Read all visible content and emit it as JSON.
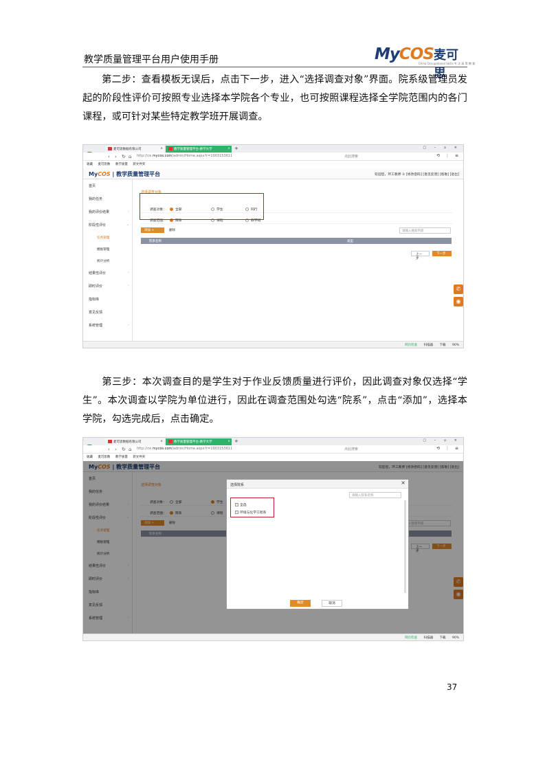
{
  "header": {
    "doc_title": "教学质量管理平台用户使用手册",
    "logo_text_my": "My",
    "logo_text_cos": "COS",
    "logo_cn": "麦可思",
    "logo_sub": "China Occupational Skills 专 注 高 等 教 育"
  },
  "paragraphs": {
    "step2": "第二步：查看模板无误后，点击下一步，进入“选择调查对象”界面。院系级管理员发起的阶段性评价可按照专业选择本学院各个专业，也可按照课程选择全学院范围内的各门课程，或可针对某些特定教学班开展调查。",
    "step3": "第三步：本次调查目的是学生对于作业反馈质量进行评价，因此调查对象仅选择“学生”。本次调查以学院为单位进行，因此在调查范围处勾选“院系”，点击“添加”，选择本学院，勾选完成后，点击确定。"
  },
  "page_number": "37",
  "browser": {
    "tab1": "麦可思数据有限公司",
    "tab2": "教学质量管理平台-教学大学",
    "url_prefix": "http://ce.",
    "url_domain": "mycos.com",
    "url_path": "/admin/Home.aspx?r=1903153611",
    "search_placeholder": "点此搜索",
    "bookmarks": [
      "收藏",
      "麦可思数",
      "教学质量",
      "新文件夹"
    ],
    "status_items": [
      "网页检查",
      "扫描器",
      "下载",
      "90%"
    ]
  },
  "app": {
    "brand_my": "My",
    "brand_cos": "COS",
    "brand_name": "| 教学质量管理平台",
    "head_links": "欢迎您，环工教师 ①   [修改密码] [意见反馈] [帮助] [退出]",
    "head_links_2": "欢迎您，环工教师   [修改密码] [意见反馈] [帮助] [退出]",
    "sidebar": [
      {
        "label": "首页"
      },
      {
        "label": "我的任务"
      },
      {
        "label": "我的评价结果"
      },
      {
        "label": "阶段性评价"
      },
      {
        "label": "任务管理",
        "sub": true,
        "active": true
      },
      {
        "label": "模板管理",
        "sub": true
      },
      {
        "label": "统计分析",
        "sub": true
      },
      {
        "label": "结果性评价"
      },
      {
        "label": "即时评价"
      },
      {
        "label": "指标库"
      },
      {
        "label": "意见反馈"
      },
      {
        "label": "系统管理"
      }
    ],
    "section_title": "选择调查对象",
    "survey_object_label": "调查对象：",
    "survey_objects": [
      "全部",
      "学生",
      "同行"
    ],
    "survey_scope_label": "调查范围：",
    "survey_scopes": [
      "院系",
      "课程",
      "教学班"
    ],
    "add_button": "添加",
    "delete_button": "删除",
    "search_placeholder": "请输入搜索内容",
    "table_columns": [
      "院系名称",
      "类型"
    ],
    "prev_button": "上一步",
    "next_button": "下一步"
  },
  "modal": {
    "title": "选择院系",
    "search_placeholder": "请输入院系名称",
    "items": [
      "全选",
      "环境与化学工程系"
    ],
    "ok_button": "确定",
    "cancel_button": "取消"
  }
}
